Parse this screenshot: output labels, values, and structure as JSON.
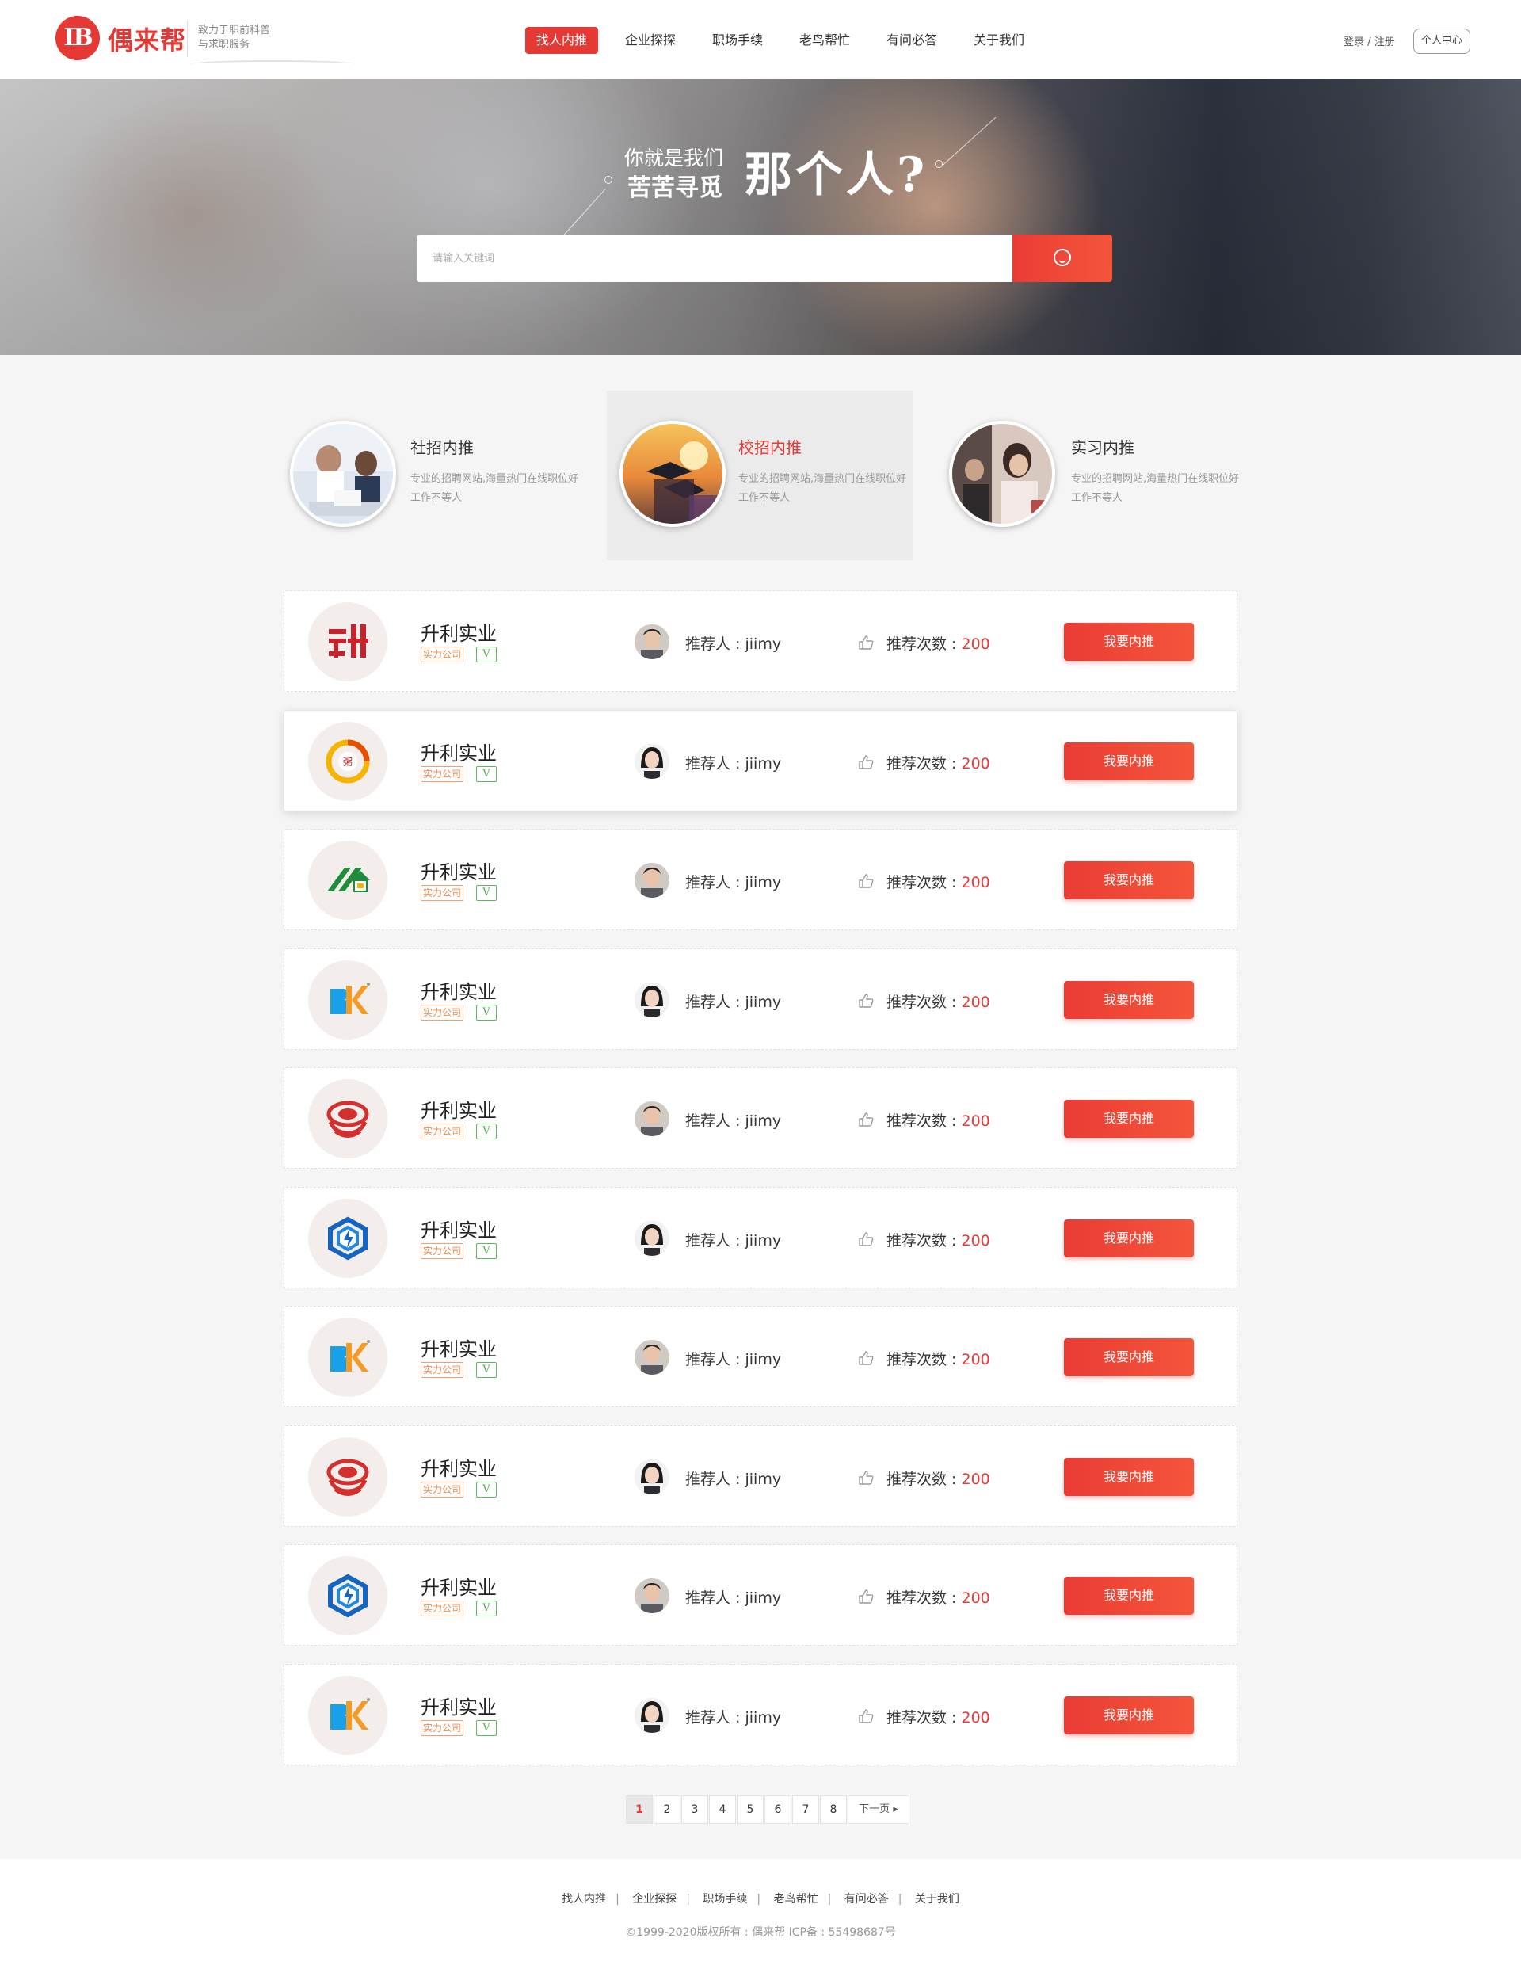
{
  "header": {
    "logo_mark": "IB",
    "logo_name": "偶来帮",
    "slogan_line1": "致力于职前科普",
    "slogan_line2": "与求职服务",
    "nav": [
      "找人内推",
      "企业探探",
      "职场手续",
      "老鸟帮忙",
      "有问必答",
      "关于我们"
    ],
    "nav_active_index": 0,
    "login": "登录",
    "auth_sep": "/",
    "register": "注册",
    "user_center": "个人中心"
  },
  "banner": {
    "line1": "你就是我们",
    "line2": "苦苦寻觅",
    "big": "那个人?",
    "search_placeholder": "请输入关键词",
    "search_icon": "search-icon"
  },
  "categories": [
    {
      "title": "社招内推",
      "desc": "专业的招聘网站,海量热门在线职位好工作不等人",
      "active": false
    },
    {
      "title": "校招内推",
      "desc": "专业的招聘网站,海量热门在线职位好工作不等人",
      "active": true
    },
    {
      "title": "实习内推",
      "desc": "专业的招聘网站,海量热门在线职位好工作不等人",
      "active": false
    }
  ],
  "list": [
    {
      "logo": "shengli-logo",
      "name": "升利实业",
      "tag": "实力公司",
      "badge": "V",
      "referrer_label": "推荐人 : ",
      "referrer": "jiimy",
      "count_label": "推荐次数 : ",
      "count": "200",
      "button": "我要内推"
    },
    {
      "logo": "ring-logo",
      "name": "升利实业",
      "tag": "实力公司",
      "badge": "V",
      "referrer_label": "推荐人 : ",
      "referrer": "jiimy",
      "count_label": "推荐次数 : ",
      "count": "200",
      "button": "我要内推"
    },
    {
      "logo": "house-logo",
      "name": "升利实业",
      "tag": "实力公司",
      "badge": "V",
      "referrer_label": "推荐人 : ",
      "referrer": "jiimy",
      "count_label": "推荐次数 : ",
      "count": "200",
      "button": "我要内推"
    },
    {
      "logo": "bk-logo",
      "name": "升利实业",
      "tag": "实力公司",
      "badge": "V",
      "referrer_label": "推荐人 : ",
      "referrer": "jiimy",
      "count_label": "推荐次数 : ",
      "count": "200",
      "button": "我要内推"
    },
    {
      "logo": "hainan-logo",
      "name": "升利实业",
      "tag": "实力公司",
      "badge": "V",
      "referrer_label": "推荐人 : ",
      "referrer": "jiimy",
      "count_label": "推荐次数 : ",
      "count": "200",
      "button": "我要内推"
    },
    {
      "logo": "hexagon-logo",
      "name": "升利实业",
      "tag": "实力公司",
      "badge": "V",
      "referrer_label": "推荐人 : ",
      "referrer": "jiimy",
      "count_label": "推荐次数 : ",
      "count": "200",
      "button": "我要内推"
    },
    {
      "logo": "bk-logo",
      "name": "升利实业",
      "tag": "实力公司",
      "badge": "V",
      "referrer_label": "推荐人 : ",
      "referrer": "jiimy",
      "count_label": "推荐次数 : ",
      "count": "200",
      "button": "我要内推"
    },
    {
      "logo": "hainan-logo",
      "name": "升利实业",
      "tag": "实力公司",
      "badge": "V",
      "referrer_label": "推荐人 : ",
      "referrer": "jiimy",
      "count_label": "推荐次数 : ",
      "count": "200",
      "button": "我要内推"
    },
    {
      "logo": "hexagon-logo",
      "name": "升利实业",
      "tag": "实力公司",
      "badge": "V",
      "referrer_label": "推荐人 : ",
      "referrer": "jiimy",
      "count_label": "推荐次数 : ",
      "count": "200",
      "button": "我要内推"
    },
    {
      "logo": "bk-logo",
      "name": "升利实业",
      "tag": "实力公司",
      "badge": "V",
      "referrer_label": "推荐人 : ",
      "referrer": "jiimy",
      "count_label": "推荐次数 : ",
      "count": "200",
      "button": "我要内推"
    }
  ],
  "pagination": {
    "pages": [
      "1",
      "2",
      "3",
      "4",
      "5",
      "6",
      "7",
      "8"
    ],
    "current": "1",
    "next": "下一页"
  },
  "footer": {
    "links": [
      "找人内推",
      "企业探探",
      "职场手续",
      "老鸟帮忙",
      "有问必答",
      "关于我们"
    ],
    "link_sep": "|",
    "copyright": "©1999-2020版权所有 : 偶来帮 ICP备 : 55498687号"
  },
  "colors": {
    "accent": "#e53935",
    "tag_orange": "#f08a4b",
    "badge_green": "#4cae4c"
  }
}
